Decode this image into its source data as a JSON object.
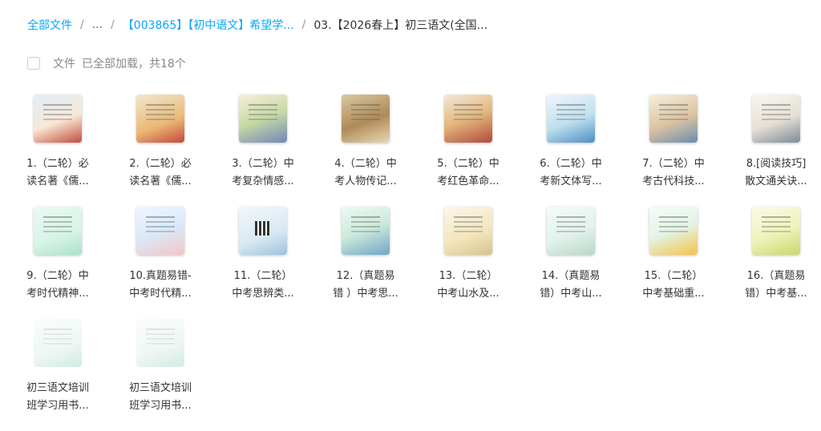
{
  "breadcrumb": {
    "items": [
      "全部文件",
      "...",
      "【003865】【初中语文】希望学...",
      "03.【2026春上】初三语文(全国..."
    ],
    "separator": "/"
  },
  "toolbar": {
    "file_label": "文件",
    "status": "已全部加载，共18个"
  },
  "files": [
    {
      "line1": "1.（二轮）必",
      "line2": "读名著《儒...",
      "thumb_icon": "doc-thumbnail"
    },
    {
      "line1": "2.（二轮）必",
      "line2": "读名著《儒...",
      "thumb_icon": "doc-thumbnail"
    },
    {
      "line1": "3.（二轮）中",
      "line2": "考复杂情感...",
      "thumb_icon": "doc-thumbnail"
    },
    {
      "line1": "4.（二轮）中",
      "line2": "考人物传记...",
      "thumb_icon": "doc-thumbnail"
    },
    {
      "line1": "5.（二轮）中",
      "line2": "考红色革命...",
      "thumb_icon": "doc-thumbnail"
    },
    {
      "line1": "6.（二轮）中",
      "line2": "考新文体写...",
      "thumb_icon": "doc-thumbnail"
    },
    {
      "line1": "7.（二轮）中",
      "line2": "考古代科技...",
      "thumb_icon": "doc-thumbnail"
    },
    {
      "line1": "8.[阅读技巧]",
      "line2": "散文通关诀...",
      "thumb_icon": "doc-thumbnail"
    },
    {
      "line1": "9.（二轮）中",
      "line2": "考时代精神...",
      "thumb_icon": "doc-thumbnail"
    },
    {
      "line1": "10.真题易错-",
      "line2": "中考时代精...",
      "thumb_icon": "doc-thumbnail"
    },
    {
      "line1": "11.（二轮）",
      "line2": "中考思辨类...",
      "thumb_icon": "qr-thumbnail"
    },
    {
      "line1": "12.（真题易",
      "line2": "错 ）中考思...",
      "thumb_icon": "doc-thumbnail"
    },
    {
      "line1": "13.（二轮）",
      "line2": "中考山水及...",
      "thumb_icon": "doc-thumbnail"
    },
    {
      "line1": "14.（真题易",
      "line2": "错）中考山...",
      "thumb_icon": "doc-thumbnail"
    },
    {
      "line1": "15.（二轮）",
      "line2": "中考基础重...",
      "thumb_icon": "doc-thumbnail"
    },
    {
      "line1": "16.（真题易",
      "line2": "错）中考基...",
      "thumb_icon": "doc-thumbnail"
    },
    {
      "line1": "初三语文培训",
      "line2": "班学习用书...",
      "thumb_icon": "doc-thumbnail"
    },
    {
      "line1": "初三语文培训",
      "line2": "班学习用书...",
      "thumb_icon": "doc-thumbnail"
    }
  ]
}
